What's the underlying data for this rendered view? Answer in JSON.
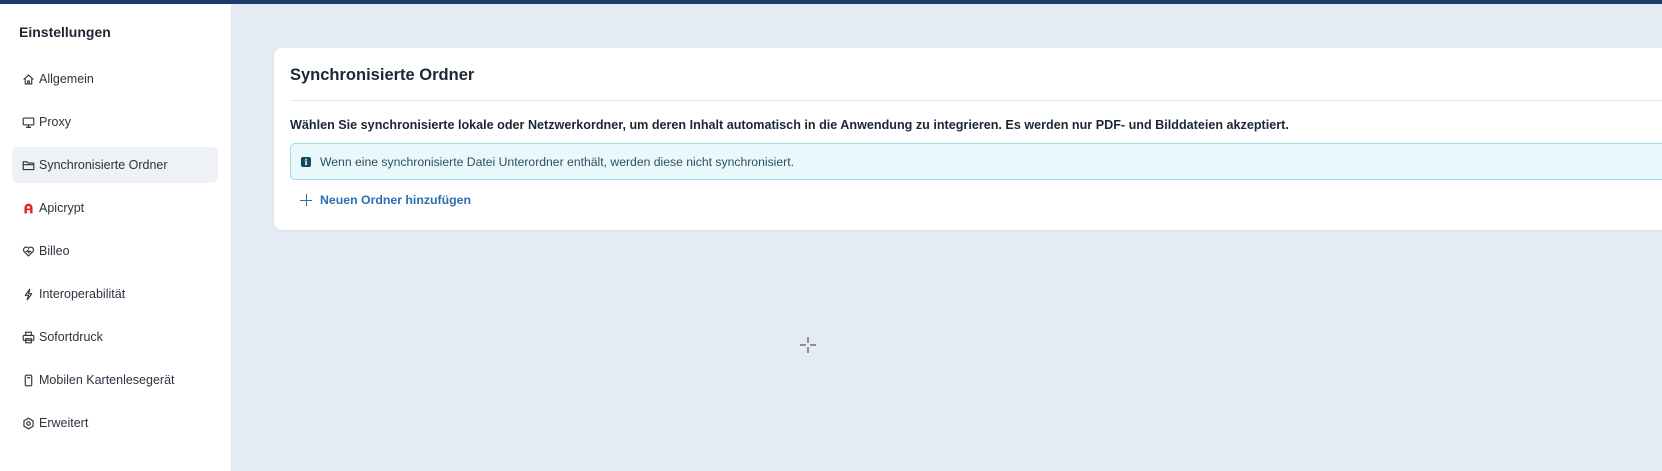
{
  "sidebar": {
    "title": "Einstellungen",
    "items": [
      {
        "label": "Allgemein",
        "icon": "home-icon"
      },
      {
        "label": "Proxy",
        "icon": "monitor-icon"
      },
      {
        "label": "Synchronisierte Ordner",
        "icon": "folder-icon",
        "active": true
      },
      {
        "label": "Apicrypt",
        "icon": "apicrypt-logo-icon"
      },
      {
        "label": "Billeo",
        "icon": "heart-icon"
      },
      {
        "label": "Interoperabilität",
        "icon": "lightning-icon"
      },
      {
        "label": "Sofortdruck",
        "icon": "printer-icon"
      },
      {
        "label": "Mobilen Kartenlesegerät",
        "icon": "card-reader-icon"
      },
      {
        "label": "Erweitert",
        "icon": "gear-icon"
      }
    ]
  },
  "main": {
    "card": {
      "title": "Synchronisierte Ordner",
      "description": "Wählen Sie synchronisierte lokale oder Netzwerkordner, um deren Inhalt automatisch in die Anwendung zu integrieren. Es werden nur PDF- und Bilddateien akzeptiert.",
      "info": "Wenn eine synchronisierte Datei Unterordner enthält, werden diese nicht synchronisiert.",
      "add_label": "Neuen Ordner hinzufügen"
    }
  },
  "colors": {
    "background": "#e5ebf4",
    "accent": "#2a6fb0",
    "info_bg": "#e9f8fb",
    "info_border": "#9fdbe8",
    "apicrypt_red": "#e02424"
  }
}
